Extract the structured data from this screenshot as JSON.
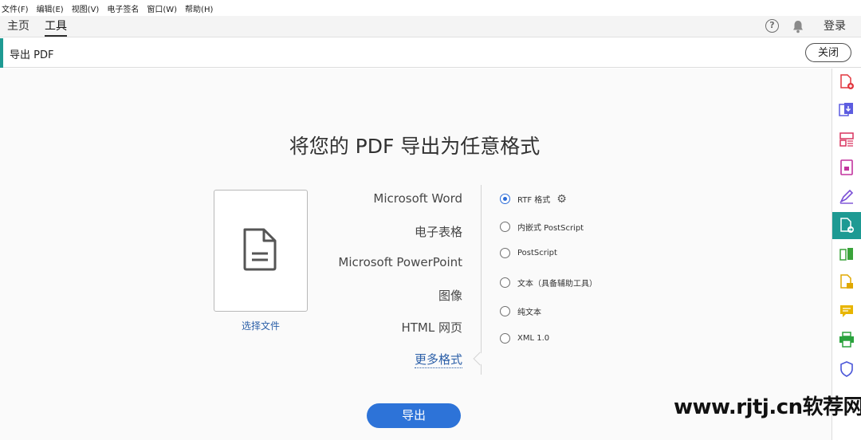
{
  "menu": {
    "items": [
      "文件(F)",
      "编辑(E)",
      "视图(V)",
      "电子签名",
      "窗口(W)",
      "帮助(H)"
    ]
  },
  "nav": {
    "tabs": [
      "主页",
      "工具"
    ],
    "active_tab": "工具",
    "help_glyph": "?",
    "login": "登录"
  },
  "tool": {
    "title": "导出 PDF",
    "close_label": "关闭"
  },
  "main": {
    "headline": "将您的 PDF 导出为任意格式",
    "choose_file": "选择文件",
    "formats": [
      "Microsoft Word",
      "电子表格",
      "Microsoft PowerPoint",
      "图像",
      "HTML 网页",
      "更多格式"
    ],
    "active_format": "更多格式",
    "options": [
      {
        "label": "RTF 格式",
        "checked": true,
        "settings_icon": "gear-icon"
      },
      {
        "label": "内嵌式 PostScript",
        "checked": false
      },
      {
        "label": "PostScript",
        "checked": false
      },
      {
        "label": "文本（具备辅助工具）",
        "checked": false
      },
      {
        "label": "纯文本",
        "checked": false
      },
      {
        "label": "XML 1.0",
        "checked": false
      }
    ],
    "export_label": "导出"
  },
  "rail": {
    "icons": [
      "create-pdf-icon",
      "export-pdf-icon",
      "organize-pages-icon",
      "edit-pdf-icon",
      "fill-sign-icon",
      "export-pdf-active-icon",
      "compare-files-icon",
      "scan-icon",
      "comment-icon",
      "print-production-icon",
      "protect-icon"
    ],
    "active_index": 5
  },
  "watermark": "www.rjtj.cn软荐网",
  "colors": {
    "accent_teal": "#1e9a93",
    "link_blue": "#2b5fa8",
    "button_blue": "#2d73d8"
  }
}
